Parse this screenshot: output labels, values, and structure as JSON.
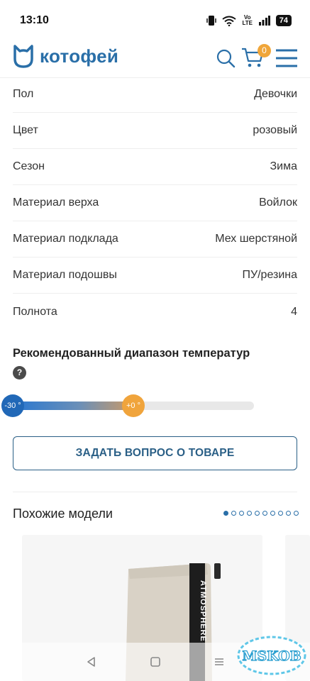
{
  "status_bar": {
    "time": "13:10",
    "battery": "74",
    "volte": "Vo LTE"
  },
  "header": {
    "logo_text": "котофей",
    "cart_count": "0"
  },
  "specs": [
    {
      "label": "Пол",
      "value": "Девочки"
    },
    {
      "label": "Цвет",
      "value": "розовый"
    },
    {
      "label": "Сезон",
      "value": "Зима"
    },
    {
      "label": "Материал верха",
      "value": "Войлок"
    },
    {
      "label": "Материал подклада",
      "value": "Мех шерстяной"
    },
    {
      "label": "Материал подошвы",
      "value": "ПУ/резина"
    },
    {
      "label": "Полнота",
      "value": "4"
    }
  ],
  "temperature": {
    "title": "Рекомендованный диапазон температур",
    "help_symbol": "?",
    "min_label": "-30 °",
    "max_label": "+0 °",
    "range_fraction": 0.49
  },
  "ask_button_label": "ЗАДАТЬ ВОПРОС О ТОВАРЕ",
  "similar": {
    "title": "Похожие модели",
    "page_count": 10,
    "active_page": 1,
    "product_text": "ATMOSPHERE"
  },
  "watermark": "MSKOB",
  "colors": {
    "brand": "#2a6fa8",
    "accent": "#f0a63a",
    "button": "#2a5f86"
  }
}
